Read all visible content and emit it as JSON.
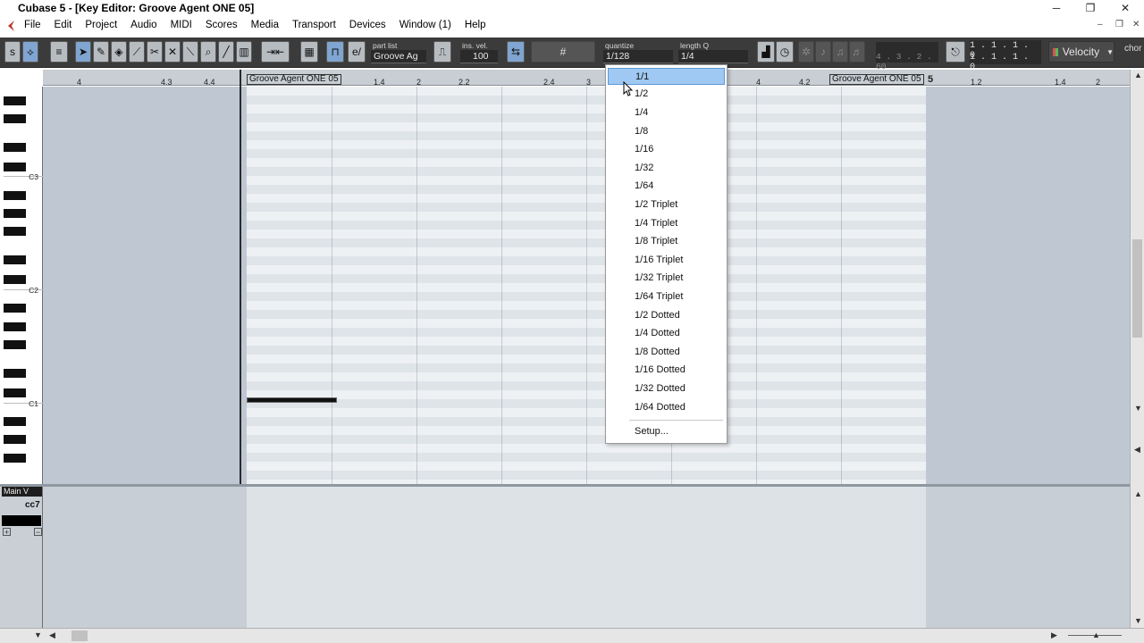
{
  "window": {
    "title": "Cubase 5 - [Key Editor: Groove Agent ONE 05]",
    "minimize": "─",
    "restore": "❐",
    "close": "✕"
  },
  "menubar": {
    "items": [
      "File",
      "Edit",
      "Project",
      "Audio",
      "MIDI",
      "Scores",
      "Media",
      "Transport",
      "Devices",
      "Window (1)",
      "Help"
    ],
    "mdi_minimize": "–",
    "mdi_restore": "❐",
    "mdi_close": "✕"
  },
  "toolbar": {
    "part_list_label": "part list",
    "part_list_value": "Groove Ag",
    "ins_vel_label": "ins. vel.",
    "ins_vel_value": "100",
    "quantize_label": "quantize",
    "quantize_value": "1/128",
    "length_label": "length Q",
    "length_value": "1/4",
    "display_1": "4 . 3 . 2 . 60",
    "display_2a": "1 . 1 . 1 .   0",
    "display_2b": "1 . 1 . 1 .   0",
    "velocity_label": "Velocity",
    "chord_label": "chor"
  },
  "ruler": {
    "ticks": [
      "4",
      "4.3",
      "4.4",
      "1.4",
      "2",
      "2.2",
      "2.4",
      "3",
      "4",
      "4.2",
      "5",
      "1.2",
      "1.4",
      "2"
    ],
    "part_label_left": "Groove Agent ONE 05",
    "part_label_right": "Groove Agent ONE 05"
  },
  "keyboard": {
    "labels": [
      "C3",
      "C2",
      "C1"
    ]
  },
  "controller": {
    "lane_menu": "Main V",
    "cc_label": "cc7"
  },
  "quantize_menu": {
    "items": [
      "1/1",
      "1/2",
      "1/4",
      "1/8",
      "1/16",
      "1/32",
      "1/64",
      "1/2 Triplet",
      "1/4 Triplet",
      "1/8 Triplet",
      "1/16 Triplet",
      "1/32 Triplet",
      "1/64 Triplet",
      "1/2 Dotted",
      "1/4 Dotted",
      "1/8 Dotted",
      "1/16 Dotted",
      "1/32 Dotted",
      "1/64 Dotted"
    ],
    "selected": "1/1",
    "setup": "Setup..."
  },
  "colors": {
    "toolbar_bg": "#3b3b3b",
    "selection": "#9fc9f2",
    "part_bg": "#eef1f4",
    "editor_bg": "#bfc8d2"
  }
}
